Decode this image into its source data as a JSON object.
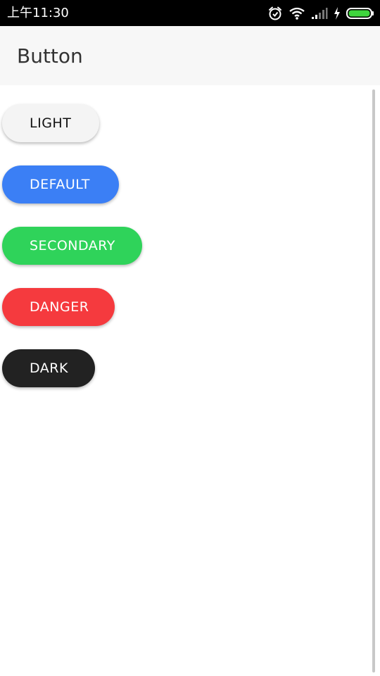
{
  "status_bar": {
    "time": "上午11:30",
    "icons": [
      "alarm-icon",
      "wifi-icon",
      "signal-icon",
      "charging-icon",
      "battery-icon"
    ],
    "battery_color": "#3fd53d"
  },
  "app_bar": {
    "title": "Button"
  },
  "buttons": [
    {
      "label": "LIGHT",
      "background": "#f4f4f4",
      "text_color": "#111111"
    },
    {
      "label": "DEFAULT",
      "background": "#3b7ff5",
      "text_color": "#ffffff"
    },
    {
      "label": "SECONDARY",
      "background": "#2fd35a",
      "text_color": "#ffffff"
    },
    {
      "label": "DANGER",
      "background": "#f53a3e",
      "text_color": "#ffffff"
    },
    {
      "label": "DARK",
      "background": "#222222",
      "text_color": "#ffffff"
    }
  ]
}
